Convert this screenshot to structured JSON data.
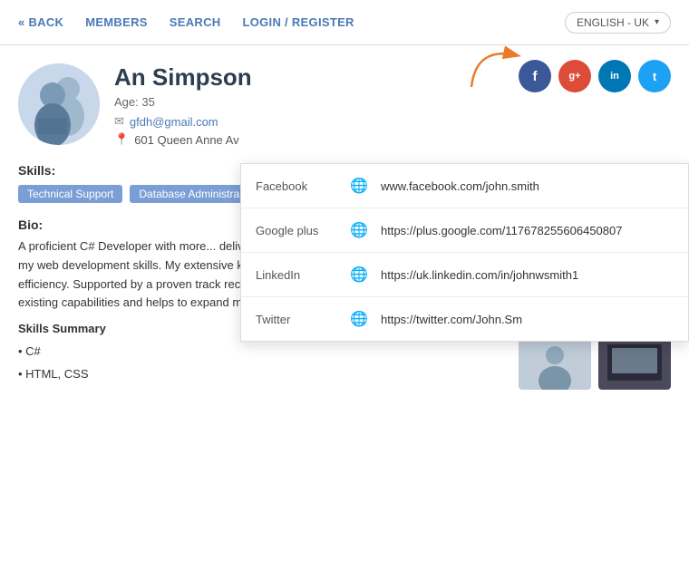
{
  "nav": {
    "back_label": "« BACK",
    "members_label": "MEMBERS",
    "search_label": "SEARCH",
    "login_label": "LOGIN / REGISTER",
    "language": "ENGLISH - UK"
  },
  "profile": {
    "name": "An Simpson",
    "age_label": "Age: 35",
    "email": "gfdh@gmail.com",
    "address": "601 Queen Anne Av",
    "skills_title": "Skills:",
    "skills": [
      "Technical Support",
      "Database Administra..."
    ],
    "bio_title": "Bio:",
    "bio_text": "A proficient C# Developer with more... delivering code to a consistently high standard, I am committed to further improving my web development skills. My extensive knowledge helps to inform practical solutions which are deployed with the utmost efficiency. Supported by a proven track record of developing .NET applications, I am seeking a role which capitalises on my existing capabilities and helps to expand my skills.",
    "skills_summary_label": "Skills Summary",
    "skill_bullets": [
      "• C#",
      "• HTML, CSS"
    ]
  },
  "social": {
    "facebook_label": "Facebook",
    "facebook_url": "www.facebook.com/john.smith",
    "googleplus_label": "Google plus",
    "googleplus_url": "https://plus.google.com/117678255606450807",
    "linkedin_label": "LinkedIn",
    "linkedin_url": "https://uk.linkedin.com/in/johnwsmith1",
    "twitter_label": "Twitter",
    "twitter_url": "https://twitter.com/John.Sm"
  },
  "icons": {
    "facebook": "f",
    "googleplus": "g+",
    "linkedin": "in",
    "twitter": "t",
    "globe": "🌐",
    "mail": "✉",
    "pin": "📍",
    "caret": "▾"
  }
}
